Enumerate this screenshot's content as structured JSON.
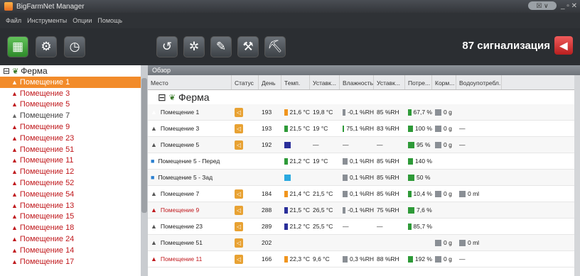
{
  "window": {
    "title": "BigFarmNet Manager",
    "pill": "☒ ∨",
    "controls": "_ ▫ ✕"
  },
  "menu": [
    "Файл",
    "Инструменты",
    "Опции",
    "Помощь"
  ],
  "alarm": {
    "text": "87 сигнализация"
  },
  "colors": {
    "selected_row": "#5b86c4",
    "selected_tree": "#f28b2a",
    "alarm_red": "#c0181c",
    "green": "#2e9a38",
    "orange": "#f0951e",
    "blue": "#2a2f9a",
    "grey": "#8a8f95"
  },
  "tree": {
    "root": "Ферма",
    "nodes": [
      {
        "label": "Помещение 1",
        "state": "selected"
      },
      {
        "label": "Помещение 3",
        "state": "alarm"
      },
      {
        "label": "Помещение 5",
        "state": "alarm"
      },
      {
        "label": "Помещение 7",
        "state": "normal"
      },
      {
        "label": "Помещение 9",
        "state": "alarm"
      },
      {
        "label": "Помещение 23",
        "state": "alarm"
      },
      {
        "label": "Помещение 51",
        "state": "alarm"
      },
      {
        "label": "Помещение 11",
        "state": "alarm"
      },
      {
        "label": "Помещение 12",
        "state": "alarm"
      },
      {
        "label": "Помещение 52",
        "state": "alarm"
      },
      {
        "label": "Помещение 54",
        "state": "alarm"
      },
      {
        "label": "Помещение 13",
        "state": "alarm"
      },
      {
        "label": "Помещение 15",
        "state": "alarm"
      },
      {
        "label": "Помещение 18",
        "state": "alarm"
      },
      {
        "label": "Помещение 24",
        "state": "alarm"
      },
      {
        "label": "Помещение 14",
        "state": "alarm"
      },
      {
        "label": "Помещение 17",
        "state": "alarm"
      }
    ]
  },
  "panel": {
    "title": "Обзор"
  },
  "grid": {
    "group": "Ферма",
    "columns": [
      "Место",
      "Статус",
      "День",
      "Темп.",
      "Уставк...",
      "Влажность",
      "Уставк...",
      "Потре...",
      "Корм...",
      "Водоупотребл..."
    ],
    "rows": [
      {
        "place": "Помещение 1",
        "icon": "red",
        "status": true,
        "day": "193",
        "temp": "21,6 °C",
        "temp_c": "orange",
        "set": "19,8 °C",
        "hum": "-0,1 %RH",
        "hum_c": "grey",
        "hset": "85 %RH",
        "cons": "67,7 %",
        "cons_c": "green",
        "feed": "0 g",
        "feed_c": "grey",
        "water": "",
        "water_c": "",
        "state": "selected"
      },
      {
        "place": "Помещение 3",
        "icon": "grey",
        "status": true,
        "day": "193",
        "temp": "21,5 °C",
        "temp_c": "green",
        "set": "19 °C",
        "hum": "75,1 %RH",
        "hum_c": "green",
        "hset": "83 %RH",
        "cons": "100 %",
        "cons_c": "green",
        "feed": "0 g",
        "feed_c": "grey",
        "water": "—",
        "water_c": "",
        "state": "alt"
      },
      {
        "place": "Помещение 5",
        "icon": "grey",
        "status": true,
        "day": "192",
        "temp": "",
        "temp_c": "blue",
        "set": "—",
        "hum": "—",
        "hum_c": "",
        "hset": "—",
        "cons": "95 %",
        "cons_c": "green",
        "feed": "0 g",
        "feed_c": "grey",
        "water": "—",
        "water_c": "",
        "state": ""
      },
      {
        "place": "Помещение 5 - Перед",
        "icon": "blue",
        "status": false,
        "day": "",
        "temp": "21,2 °C",
        "temp_c": "green",
        "set": "19 °C",
        "hum": "0,1 %RH",
        "hum_c": "grey",
        "hset": "85 %RH",
        "cons": "140 %",
        "cons_c": "green",
        "feed": "",
        "feed_c": "",
        "water": "",
        "water_c": "",
        "state": "alt"
      },
      {
        "place": "Помещение 5 - Зад",
        "icon": "blue",
        "status": false,
        "day": "",
        "temp": "",
        "temp_c": "cyan",
        "set": "",
        "hum": "0,1 %RH",
        "hum_c": "grey",
        "hset": "85 %RH",
        "cons": "50 %",
        "cons_c": "green",
        "feed": "",
        "feed_c": "",
        "water": "",
        "water_c": "",
        "state": ""
      },
      {
        "place": "Помещение 7",
        "icon": "grey",
        "status": true,
        "day": "184",
        "temp": "21,4 °C",
        "temp_c": "orange",
        "set": "21,5 °C",
        "hum": "0,1 %RH",
        "hum_c": "grey",
        "hset": "85 %RH",
        "cons": "10,4 %",
        "cons_c": "green",
        "feed": "0 g",
        "feed_c": "grey",
        "water": "0 ml",
        "water_c": "grey",
        "state": "alt"
      },
      {
        "place": "Помещение 9",
        "icon": "red",
        "status": true,
        "day": "288",
        "temp": "21,5 °C",
        "temp_c": "blue",
        "set": "26,5 °C",
        "hum": "-0,1 %RH",
        "hum_c": "grey",
        "hset": "75 %RH",
        "cons": "7,6 %",
        "cons_c": "green",
        "feed": "",
        "feed_c": "",
        "water": "",
        "water_c": "",
        "state": ""
      },
      {
        "place": "Помещение 23",
        "icon": "grey",
        "status": true,
        "day": "289",
        "temp": "21,2 °C",
        "temp_c": "blue",
        "set": "25,5 °C",
        "hum": "—",
        "hum_c": "",
        "hset": "—",
        "cons": "85,7 %",
        "cons_c": "green",
        "feed": "",
        "feed_c": "",
        "water": "",
        "water_c": "",
        "state": "alt"
      },
      {
        "place": "Помещение 51",
        "icon": "grey",
        "status": true,
        "day": "202",
        "temp": "",
        "temp_c": "",
        "set": "",
        "hum": "",
        "hum_c": "",
        "hset": "",
        "cons": "",
        "cons_c": "",
        "feed": "0 g",
        "feed_c": "grey",
        "water": "0 ml",
        "water_c": "grey",
        "state": ""
      },
      {
        "place": "Помещение 11",
        "icon": "red",
        "status": true,
        "day": "166",
        "temp": "22,3 °C",
        "temp_c": "orange",
        "set": "9,6 °C",
        "hum": "0,3 %RH",
        "hum_c": "grey",
        "hset": "88 %RH",
        "cons": "192 %",
        "cons_c": "green",
        "feed": "0 g",
        "feed_c": "grey",
        "water": "—",
        "water_c": "",
        "state": "alt"
      }
    ]
  }
}
